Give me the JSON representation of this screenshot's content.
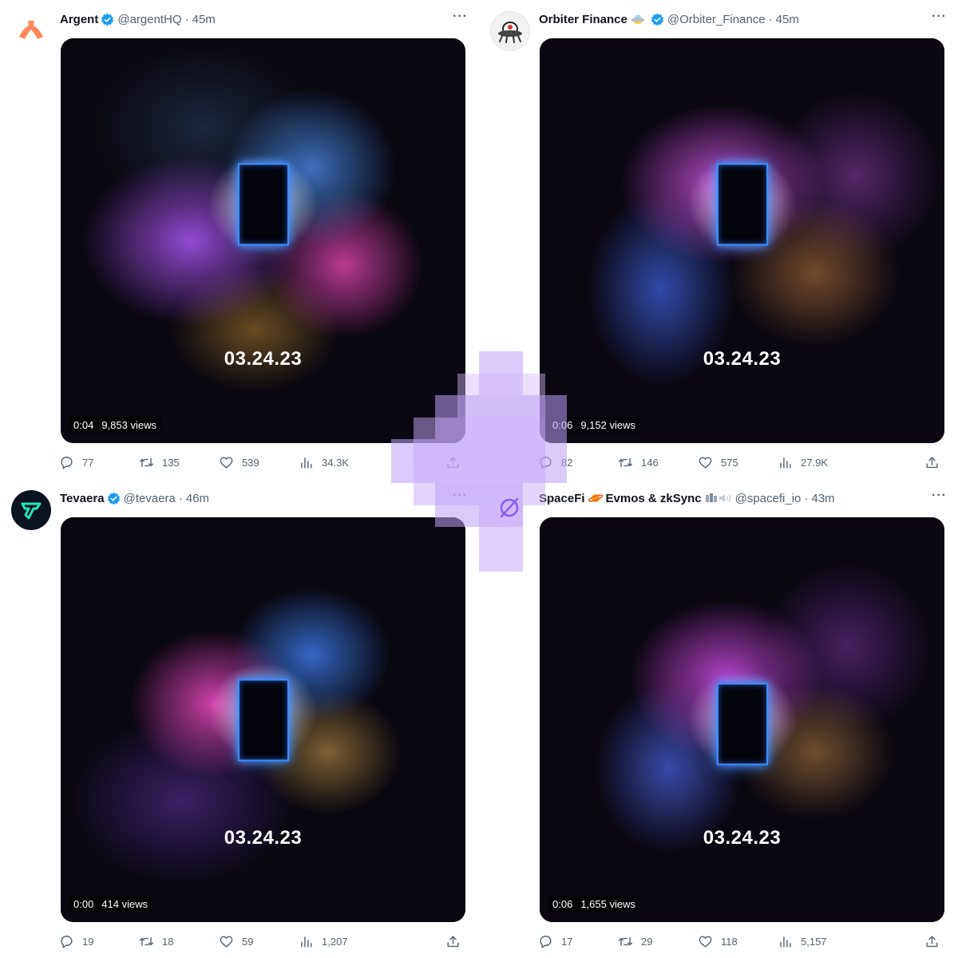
{
  "tweets": [
    {
      "name": "Argent",
      "handle": "@argentHQ",
      "time": "45m",
      "date_text": "03.24.23",
      "video_time": "0:04",
      "video_views": "9,853 views",
      "replies": "77",
      "retweets": "135",
      "likes": "539",
      "views": "34.3K",
      "avatar_icon": "argent-logo-icon",
      "accent": "#ff875b"
    },
    {
      "name": "Orbiter Finance",
      "handle": "@Orbiter_Finance",
      "time": "45m",
      "date_text": "03.24.23",
      "video_time": "0:06",
      "video_views": "9,152 views",
      "replies": "82",
      "retweets": "146",
      "likes": "575",
      "views": "27.9K",
      "avatar_icon": "orbiter-ufo-icon",
      "accent": "#e0e0e0"
    },
    {
      "name": "Tevaera",
      "handle": "@tevaera",
      "time": "46m",
      "date_text": "03.24.23",
      "video_time": "0:00",
      "video_views": "414 views",
      "replies": "19",
      "retweets": "18",
      "likes": "59",
      "views": "1,207",
      "avatar_icon": "tevaera-logo-icon",
      "accent": "#1de9b6"
    },
    {
      "name": "SpaceFi",
      "name_suffix": "Evmos & zkSync",
      "handle": "@spacefi_io",
      "time": "43m",
      "date_text": "03.24.23",
      "video_time": "0:06",
      "video_views": "1,655 views",
      "replies": "17",
      "retweets": "29",
      "likes": "118",
      "views": "5,157",
      "avatar_icon": "",
      "accent": "#ff9f1c"
    }
  ],
  "colors": {
    "verified": "#1d9bf0",
    "text_secondary": "#536471",
    "door_glow": "#3f8cff",
    "watermark": "#bea0fa"
  }
}
